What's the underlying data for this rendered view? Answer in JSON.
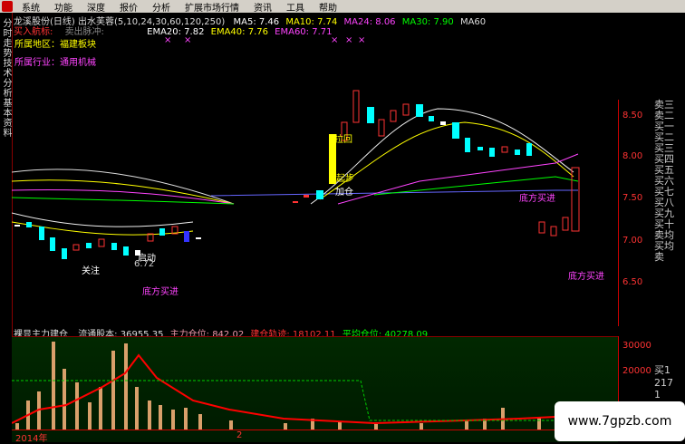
{
  "menu": {
    "items": [
      "系统",
      "功能",
      "深度",
      "报价",
      "分析",
      "扩展市场行情",
      "资讯",
      "工具",
      "帮助"
    ]
  },
  "side_tabs": [
    "分时走势",
    "技术分析",
    "基本资料"
  ],
  "chart_header": {
    "title": "龙溪股份(日线) 出水芙蓉(5,10,24,30,60,120,250)",
    "ma5": "MA5: 7.46",
    "ma10": "MA10: 7.74",
    "ma24": "MA24: 8.06",
    "ma30": "MA30: 7.90",
    "ma60": "MA60",
    "ema20": "EMA20: 7.82",
    "ema40": "EMA40: 7.76",
    "ema60": "EMA60: 7.71",
    "buy_label": "买入航标:",
    "sell_label": "卖出脉冲:"
  },
  "info": {
    "region": "所属地区：福建板块",
    "industry": "所属行业：通用机械"
  },
  "colors": {
    "ma5": "#ffffff",
    "ma10": "#ffff00",
    "ma24": "#ff40ff",
    "ma30": "#00ff00",
    "ema20": "#ffffff",
    "ema40": "#ffff00",
    "ema60": "#ff40ff"
  },
  "price_ticks": [
    "8.50",
    "8.00",
    "7.50",
    "7.00",
    "6.50"
  ],
  "right_panel": [
    "卖三",
    "卖二",
    "买一",
    "买二",
    "买三",
    "买四",
    "买五",
    "买六",
    "买七",
    "买八",
    "买九",
    "买十",
    "卖均",
    "买均",
    "卖"
  ],
  "annotations": {
    "guanzhu": "关注",
    "qidong": "启动",
    "v672": "6.72",
    "dfmj": "底方买进",
    "dfmj2": "底方买进",
    "dfmj3": "底方买进",
    "qibu": "起步",
    "jiacang": "加仓",
    "xiandong": "拉回"
  },
  "lower_header": {
    "name": "裸显主力建仓",
    "ltgb": "流通股本: 36955.35",
    "zlcw": "主力仓位: 842.02",
    "jcgj": "建仓轨迹: 18102.11",
    "pjcw": "平均仓位: 40278.09"
  },
  "low_ticks": [
    "30000",
    "20000"
  ],
  "low_panel": [
    "买1",
    "217",
    "1"
  ],
  "dates": [
    "2014年",
    "2"
  ],
  "watermark": "www.7gpzb.com"
}
